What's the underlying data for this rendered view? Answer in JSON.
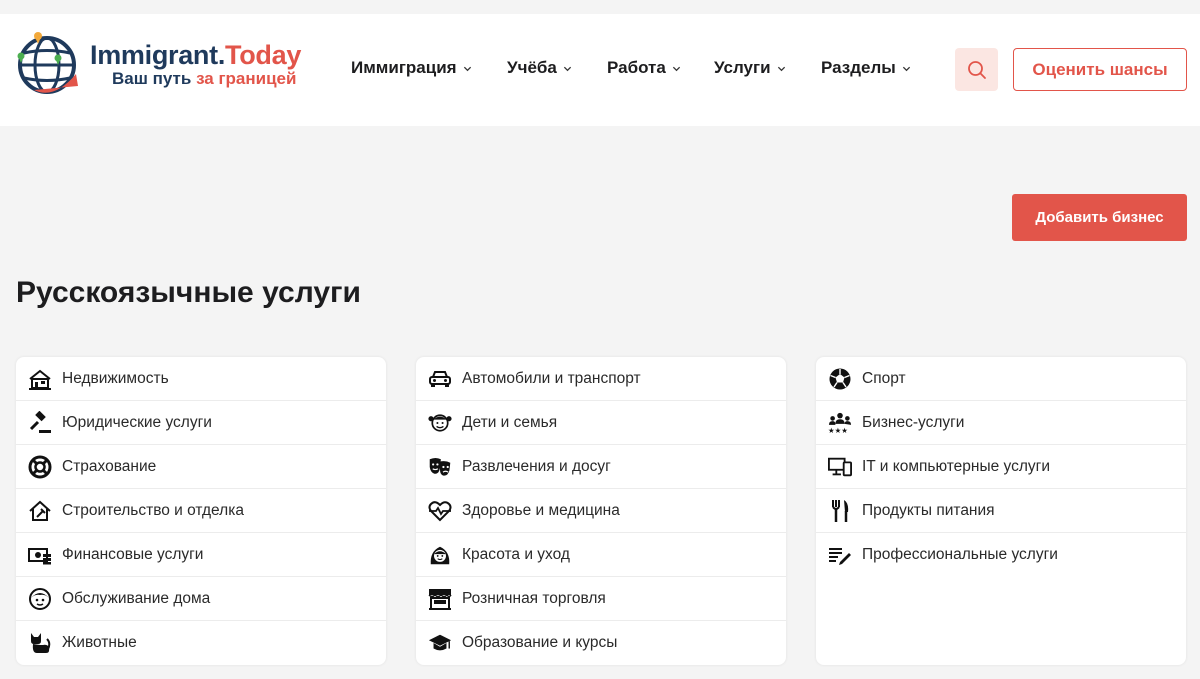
{
  "header": {
    "logo": {
      "title_main": "Immigrant.",
      "title_accent": "Today",
      "subtitle_main": "Ваш путь ",
      "subtitle_accent": "за границей"
    },
    "nav": [
      {
        "label": "Иммиграция"
      },
      {
        "label": "Учёба"
      },
      {
        "label": "Работа"
      },
      {
        "label": "Услуги"
      },
      {
        "label": "Разделы"
      }
    ],
    "search_icon": "search-icon",
    "chances_button": "Оценить шансы"
  },
  "add_business_button": "Добавить бизнес",
  "page_title": "Русскоязычные услуги",
  "colors": {
    "accent": "#e2554a",
    "brand_dark": "#1f3a5c",
    "background": "#f4f4f4"
  },
  "categories": {
    "col1": [
      {
        "label": "Недвижимость",
        "icon": "real-estate-icon"
      },
      {
        "label": "Юридические услуги",
        "icon": "gavel-icon"
      },
      {
        "label": "Страхование",
        "icon": "lifebuoy-icon"
      },
      {
        "label": "Строительство и отделка",
        "icon": "house-hammer-icon"
      },
      {
        "label": "Финансовые услуги",
        "icon": "money-icon"
      },
      {
        "label": "Обслуживание дома",
        "icon": "house-maid-icon"
      },
      {
        "label": "Животные",
        "icon": "cat-icon"
      }
    ],
    "col2": [
      {
        "label": "Автомобили и транспорт",
        "icon": "car-icon"
      },
      {
        "label": "Дети и семья",
        "icon": "child-icon"
      },
      {
        "label": "Развлечения и досуг",
        "icon": "theater-masks-icon"
      },
      {
        "label": "Здоровье и медицина",
        "icon": "heart-pulse-icon"
      },
      {
        "label": "Красота и уход",
        "icon": "woman-icon"
      },
      {
        "label": "Розничная торговля",
        "icon": "shop-icon"
      },
      {
        "label": "Образование и курсы",
        "icon": "graduation-cap-icon"
      }
    ],
    "col3": [
      {
        "label": "Спорт",
        "icon": "soccer-ball-icon"
      },
      {
        "label": "Бизнес-услуги",
        "icon": "group-stars-icon"
      },
      {
        "label": "IT и компьютерные услуги",
        "icon": "devices-icon"
      },
      {
        "label": "Продукты питания",
        "icon": "cutlery-icon"
      },
      {
        "label": "Профессиональные услуги",
        "icon": "list-pen-icon"
      }
    ]
  }
}
